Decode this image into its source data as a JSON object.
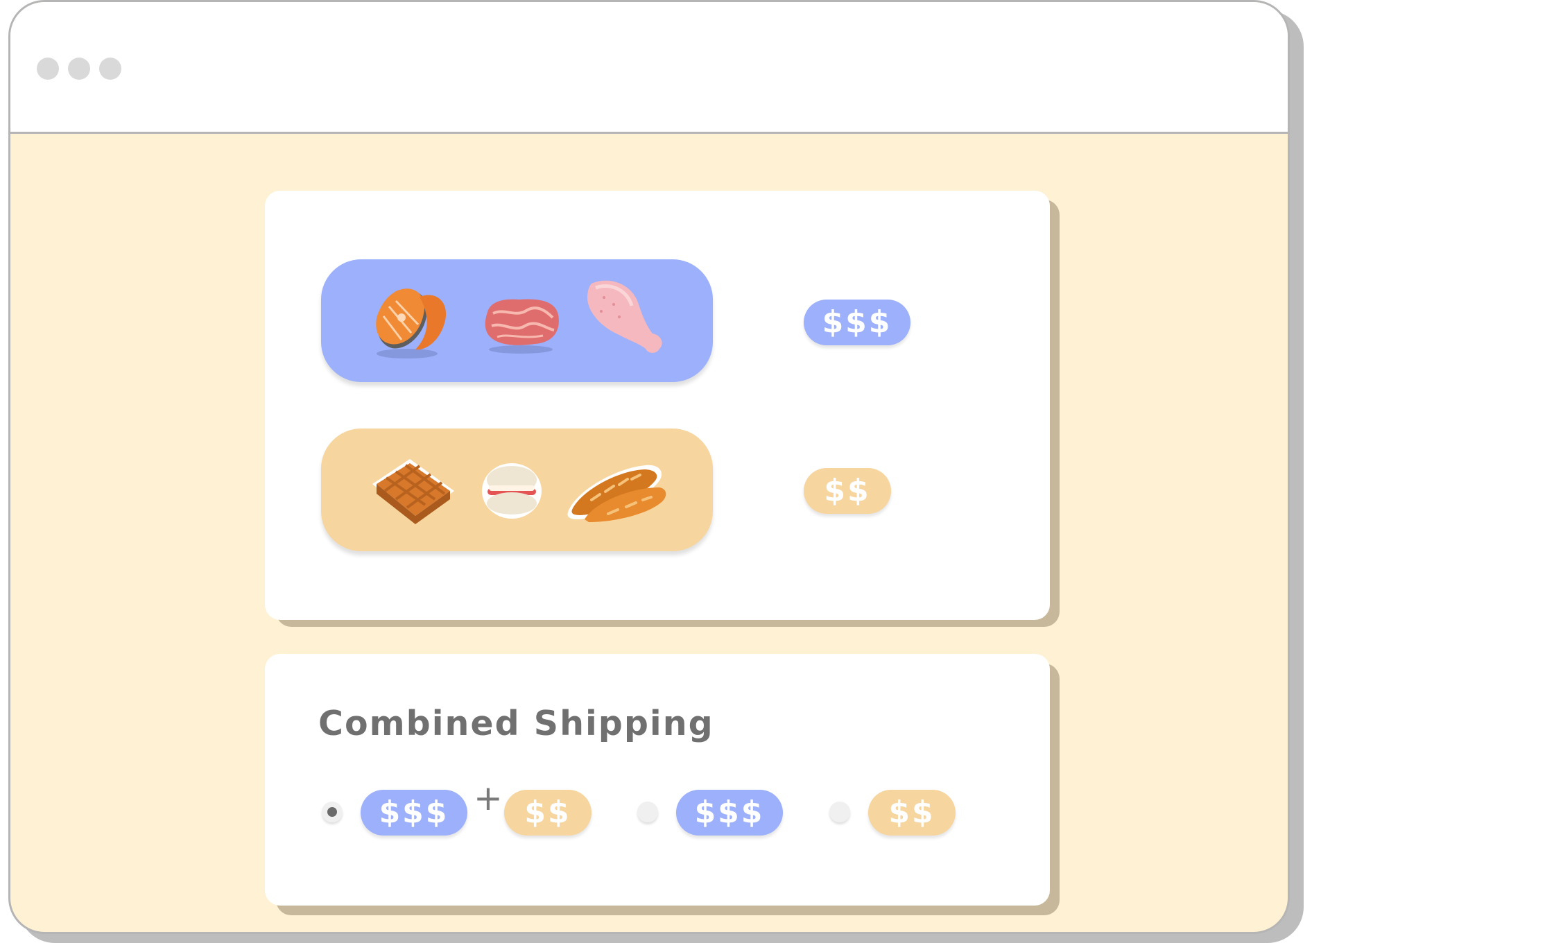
{
  "window": {
    "controls": [
      "dot",
      "dot",
      "dot"
    ]
  },
  "products": {
    "meat_group": {
      "items": [
        "salmon-steak-icon",
        "beef-steak-icon",
        "chicken-leg-icon"
      ],
      "color": "#9cb0fb",
      "price": "$$$"
    },
    "bakery_group": {
      "items": [
        "waffle-icon",
        "macaron-icon",
        "baguette-icon"
      ],
      "color": "#f7d59f",
      "price": "$$"
    }
  },
  "shipping": {
    "title": "Combined Shipping",
    "options": [
      {
        "selected": true,
        "prices": [
          "$$$",
          "$$"
        ],
        "joiner": "+"
      },
      {
        "selected": false,
        "prices": [
          "$$$"
        ]
      },
      {
        "selected": false,
        "prices": [
          "$$"
        ]
      }
    ]
  },
  "colors": {
    "background": "#fff2d4",
    "blue": "#9cb0fb",
    "tan": "#f7d59f",
    "card_shadow": "#c7b89b"
  }
}
